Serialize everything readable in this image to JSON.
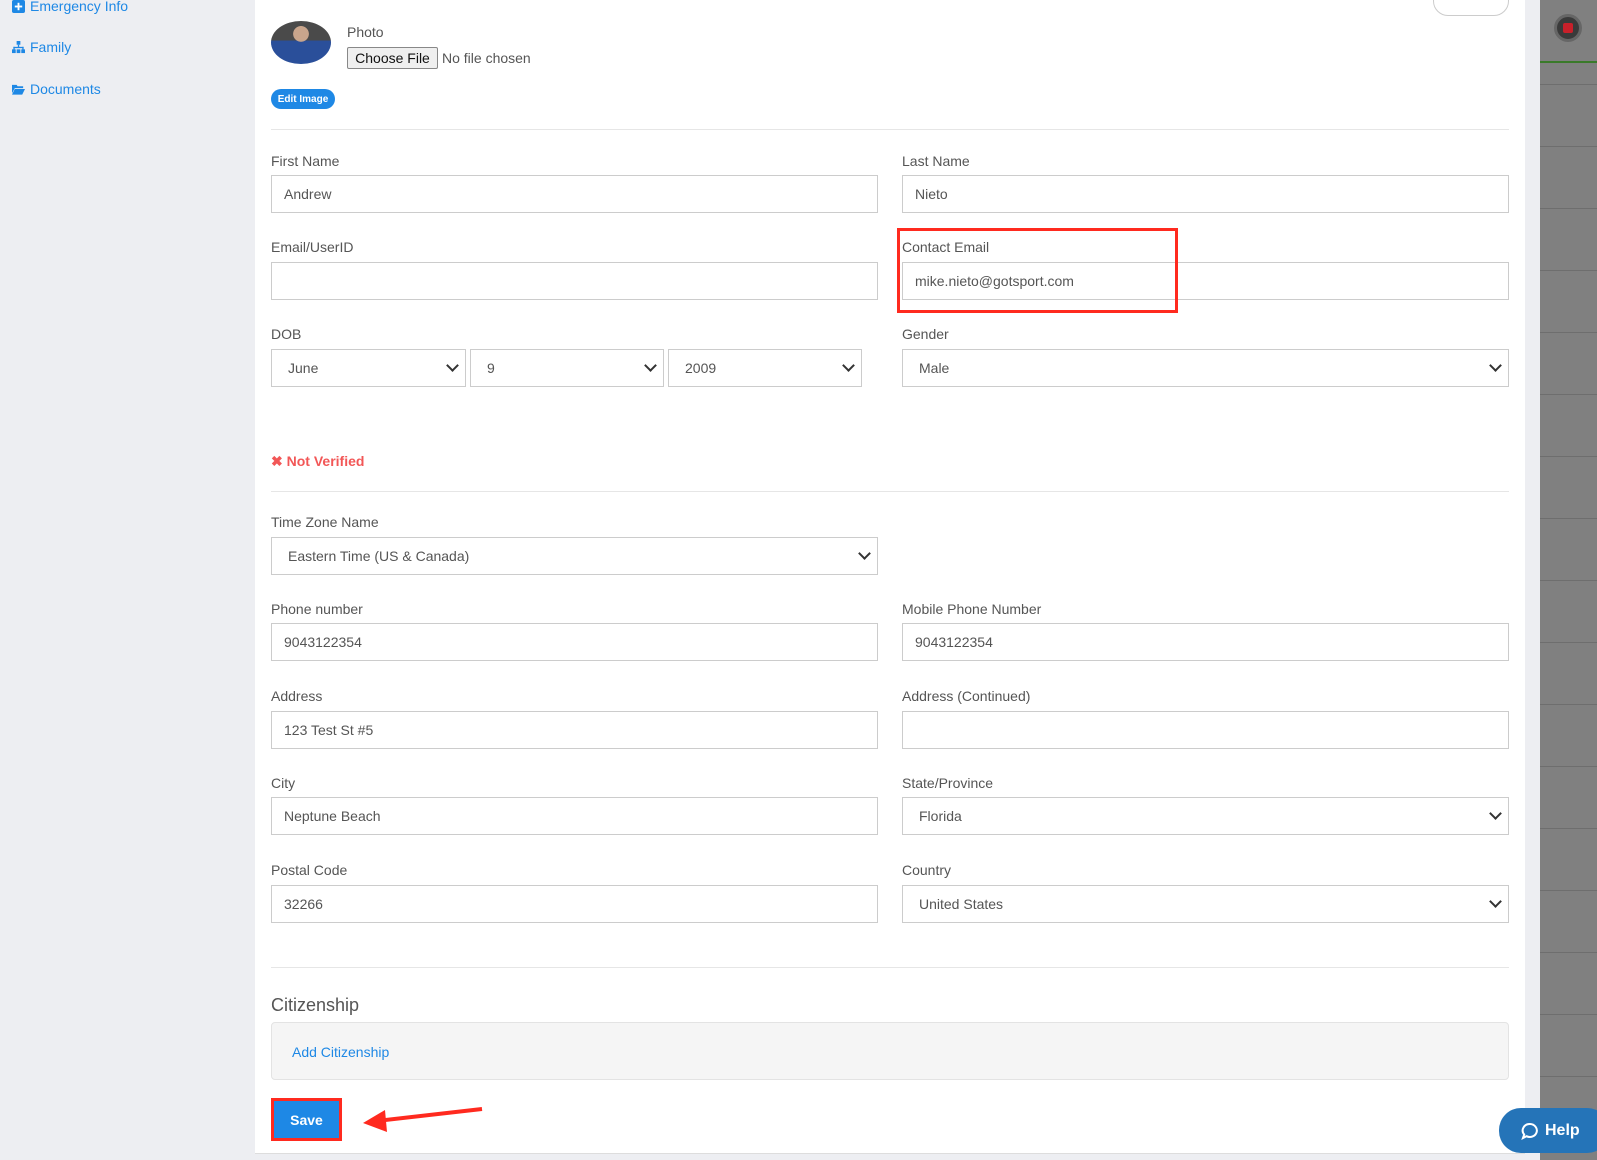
{
  "sidebar": {
    "items": [
      {
        "label": "Emergency Info",
        "icon": "plus-square-icon"
      },
      {
        "label": "Family",
        "icon": "sitemap-icon"
      },
      {
        "label": "Documents",
        "icon": "folder-open-icon"
      }
    ]
  },
  "photo": {
    "label": "Photo",
    "choose_file": "Choose File",
    "no_file": "No file chosen",
    "edit_image": "Edit Image"
  },
  "form": {
    "first_name": {
      "label": "First Name",
      "value": "Andrew"
    },
    "last_name": {
      "label": "Last Name",
      "value": "Nieto"
    },
    "email_userid": {
      "label": "Email/UserID",
      "value": ""
    },
    "contact_email": {
      "label": "Contact Email",
      "value": "mike.nieto@gotsport.com"
    },
    "dob": {
      "label": "DOB",
      "month": "June",
      "day": "9",
      "year": "2009"
    },
    "gender": {
      "label": "Gender",
      "value": "Male"
    },
    "verification": "Not Verified",
    "time_zone": {
      "label": "Time Zone Name",
      "value": "Eastern Time (US & Canada)"
    },
    "phone": {
      "label": "Phone number",
      "value": "9043122354"
    },
    "mobile": {
      "label": "Mobile Phone Number",
      "value": "9043122354"
    },
    "address": {
      "label": "Address",
      "value": "123 Test St #5"
    },
    "address2": {
      "label": "Address (Continued)",
      "value": ""
    },
    "city": {
      "label": "City",
      "value": "Neptune Beach"
    },
    "state": {
      "label": "State/Province",
      "value": "Florida"
    },
    "postal": {
      "label": "Postal Code",
      "value": "32266"
    },
    "country": {
      "label": "Country",
      "value": "United States"
    }
  },
  "citizenship": {
    "heading": "Citizenship",
    "add_label": "Add Citizenship"
  },
  "save_label": "Save",
  "help_label": "Help",
  "colors": {
    "accent": "#1e88e5",
    "annotation": "#ff2a1f",
    "error": "#f25757"
  }
}
